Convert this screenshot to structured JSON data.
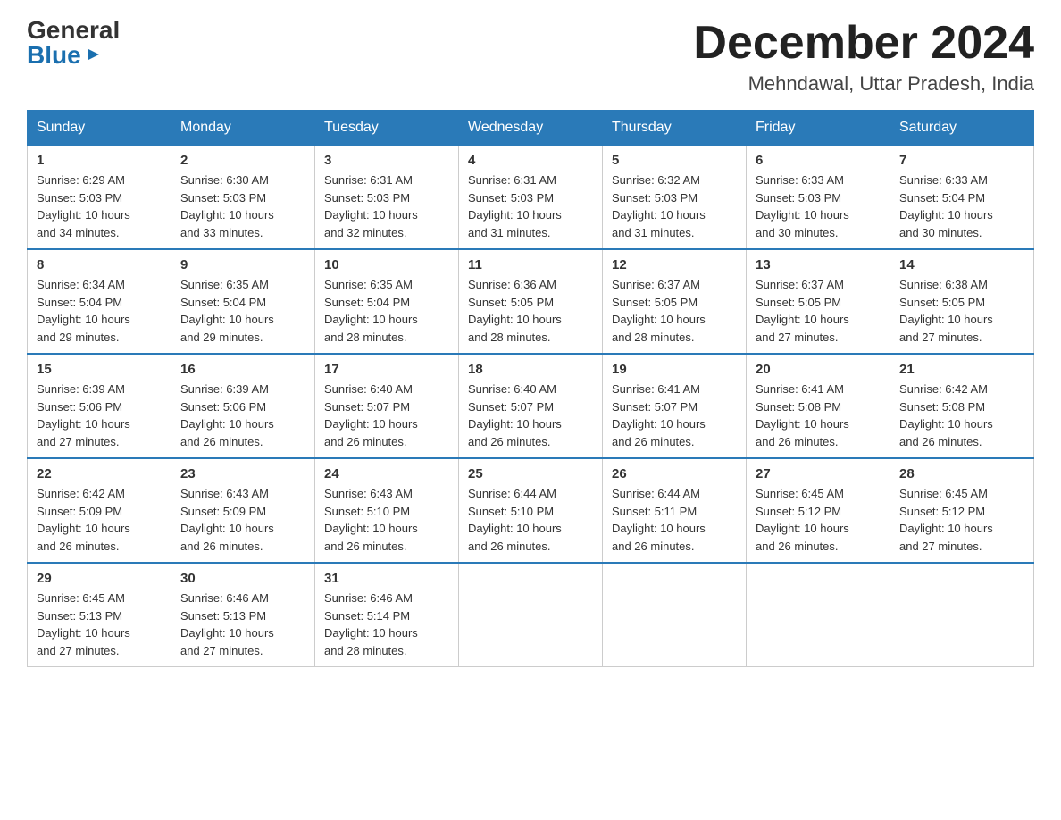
{
  "logo": {
    "general": "General",
    "blue": "Blue"
  },
  "title": {
    "month_year": "December 2024",
    "location": "Mehndawal, Uttar Pradesh, India"
  },
  "days_of_week": [
    "Sunday",
    "Monday",
    "Tuesday",
    "Wednesday",
    "Thursday",
    "Friday",
    "Saturday"
  ],
  "weeks": [
    [
      {
        "day": "1",
        "sunrise": "6:29 AM",
        "sunset": "5:03 PM",
        "daylight": "10 hours and 34 minutes."
      },
      {
        "day": "2",
        "sunrise": "6:30 AM",
        "sunset": "5:03 PM",
        "daylight": "10 hours and 33 minutes."
      },
      {
        "day": "3",
        "sunrise": "6:31 AM",
        "sunset": "5:03 PM",
        "daylight": "10 hours and 32 minutes."
      },
      {
        "day": "4",
        "sunrise": "6:31 AM",
        "sunset": "5:03 PM",
        "daylight": "10 hours and 31 minutes."
      },
      {
        "day": "5",
        "sunrise": "6:32 AM",
        "sunset": "5:03 PM",
        "daylight": "10 hours and 31 minutes."
      },
      {
        "day": "6",
        "sunrise": "6:33 AM",
        "sunset": "5:03 PM",
        "daylight": "10 hours and 30 minutes."
      },
      {
        "day": "7",
        "sunrise": "6:33 AM",
        "sunset": "5:04 PM",
        "daylight": "10 hours and 30 minutes."
      }
    ],
    [
      {
        "day": "8",
        "sunrise": "6:34 AM",
        "sunset": "5:04 PM",
        "daylight": "10 hours and 29 minutes."
      },
      {
        "day": "9",
        "sunrise": "6:35 AM",
        "sunset": "5:04 PM",
        "daylight": "10 hours and 29 minutes."
      },
      {
        "day": "10",
        "sunrise": "6:35 AM",
        "sunset": "5:04 PM",
        "daylight": "10 hours and 28 minutes."
      },
      {
        "day": "11",
        "sunrise": "6:36 AM",
        "sunset": "5:05 PM",
        "daylight": "10 hours and 28 minutes."
      },
      {
        "day": "12",
        "sunrise": "6:37 AM",
        "sunset": "5:05 PM",
        "daylight": "10 hours and 28 minutes."
      },
      {
        "day": "13",
        "sunrise": "6:37 AM",
        "sunset": "5:05 PM",
        "daylight": "10 hours and 27 minutes."
      },
      {
        "day": "14",
        "sunrise": "6:38 AM",
        "sunset": "5:05 PM",
        "daylight": "10 hours and 27 minutes."
      }
    ],
    [
      {
        "day": "15",
        "sunrise": "6:39 AM",
        "sunset": "5:06 PM",
        "daylight": "10 hours and 27 minutes."
      },
      {
        "day": "16",
        "sunrise": "6:39 AM",
        "sunset": "5:06 PM",
        "daylight": "10 hours and 26 minutes."
      },
      {
        "day": "17",
        "sunrise": "6:40 AM",
        "sunset": "5:07 PM",
        "daylight": "10 hours and 26 minutes."
      },
      {
        "day": "18",
        "sunrise": "6:40 AM",
        "sunset": "5:07 PM",
        "daylight": "10 hours and 26 minutes."
      },
      {
        "day": "19",
        "sunrise": "6:41 AM",
        "sunset": "5:07 PM",
        "daylight": "10 hours and 26 minutes."
      },
      {
        "day": "20",
        "sunrise": "6:41 AM",
        "sunset": "5:08 PM",
        "daylight": "10 hours and 26 minutes."
      },
      {
        "day": "21",
        "sunrise": "6:42 AM",
        "sunset": "5:08 PM",
        "daylight": "10 hours and 26 minutes."
      }
    ],
    [
      {
        "day": "22",
        "sunrise": "6:42 AM",
        "sunset": "5:09 PM",
        "daylight": "10 hours and 26 minutes."
      },
      {
        "day": "23",
        "sunrise": "6:43 AM",
        "sunset": "5:09 PM",
        "daylight": "10 hours and 26 minutes."
      },
      {
        "day": "24",
        "sunrise": "6:43 AM",
        "sunset": "5:10 PM",
        "daylight": "10 hours and 26 minutes."
      },
      {
        "day": "25",
        "sunrise": "6:44 AM",
        "sunset": "5:10 PM",
        "daylight": "10 hours and 26 minutes."
      },
      {
        "day": "26",
        "sunrise": "6:44 AM",
        "sunset": "5:11 PM",
        "daylight": "10 hours and 26 minutes."
      },
      {
        "day": "27",
        "sunrise": "6:45 AM",
        "sunset": "5:12 PM",
        "daylight": "10 hours and 26 minutes."
      },
      {
        "day": "28",
        "sunrise": "6:45 AM",
        "sunset": "5:12 PM",
        "daylight": "10 hours and 27 minutes."
      }
    ],
    [
      {
        "day": "29",
        "sunrise": "6:45 AM",
        "sunset": "5:13 PM",
        "daylight": "10 hours and 27 minutes."
      },
      {
        "day": "30",
        "sunrise": "6:46 AM",
        "sunset": "5:13 PM",
        "daylight": "10 hours and 27 minutes."
      },
      {
        "day": "31",
        "sunrise": "6:46 AM",
        "sunset": "5:14 PM",
        "daylight": "10 hours and 28 minutes."
      },
      null,
      null,
      null,
      null
    ]
  ],
  "labels": {
    "sunrise": "Sunrise:",
    "sunset": "Sunset:",
    "daylight": "Daylight:"
  }
}
